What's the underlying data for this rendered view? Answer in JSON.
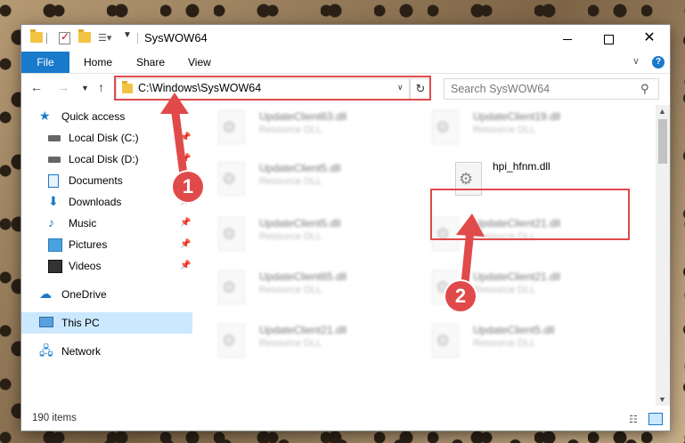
{
  "window": {
    "title": "SysWOW64",
    "minimize_label": "",
    "maximize_label": "",
    "close_label": "✕"
  },
  "ribbon": {
    "tabs": [
      "File",
      "Home",
      "Share",
      "View"
    ],
    "help": "?"
  },
  "nav": {
    "address": "C:\\Windows\\SysWOW64",
    "search_placeholder": "Search SysWOW64"
  },
  "sidebar": {
    "items": [
      {
        "label": "Quick access",
        "icon": "star-icon",
        "pinned": false
      },
      {
        "label": "Local Disk (C:)",
        "icon": "disk-icon",
        "pinned": true
      },
      {
        "label": "Local Disk (D:)",
        "icon": "disk-icon",
        "pinned": true
      },
      {
        "label": "Documents",
        "icon": "documents-icon",
        "pinned": true
      },
      {
        "label": "Downloads",
        "icon": "downloads-icon",
        "pinned": true
      },
      {
        "label": "Music",
        "icon": "music-icon",
        "pinned": true
      },
      {
        "label": "Pictures",
        "icon": "pictures-icon",
        "pinned": true
      },
      {
        "label": "Videos",
        "icon": "videos-icon",
        "pinned": true
      },
      {
        "label": "OneDrive",
        "icon": "cloud-icon",
        "pinned": false
      },
      {
        "label": "This PC",
        "icon": "pc-icon",
        "pinned": false,
        "selected": true
      },
      {
        "label": "Network",
        "icon": "network-icon",
        "pinned": false
      }
    ]
  },
  "files": [
    {
      "name": "UpdateClient63.dll",
      "type": "Resource DLL",
      "blurred": true
    },
    {
      "name": "UpdateClient19.dll",
      "type": "Resource DLL",
      "blurred": true
    },
    {
      "name": "UpdateClient5.dll",
      "type": "Resource DLL",
      "blurred": true
    },
    {
      "name": "hpi_hfnm.dll",
      "type": "",
      "blurred": false
    },
    {
      "name": "UpdateClient5.dll",
      "type": "Resource DLL",
      "blurred": true
    },
    {
      "name": "UpdateClient21.dll",
      "type": "Resource DLL",
      "blurred": true
    },
    {
      "name": "UpdateClient65.dll",
      "type": "Resource DLL",
      "blurred": true
    },
    {
      "name": "UpdateClient21.dll",
      "type": "Resource DLL",
      "blurred": true
    },
    {
      "name": "UpdateClient21.dll",
      "type": "Resource DLL",
      "blurred": true
    },
    {
      "name": "UpdateClient5.dll",
      "type": "Resource DLL",
      "blurred": true
    }
  ],
  "status": {
    "item_count": "190 items"
  },
  "annotations": {
    "marker_1": "1",
    "marker_2": "2"
  },
  "colors": {
    "accent": "#1979ca",
    "highlight": "#e04a4a",
    "selected": "#cce8ff"
  }
}
